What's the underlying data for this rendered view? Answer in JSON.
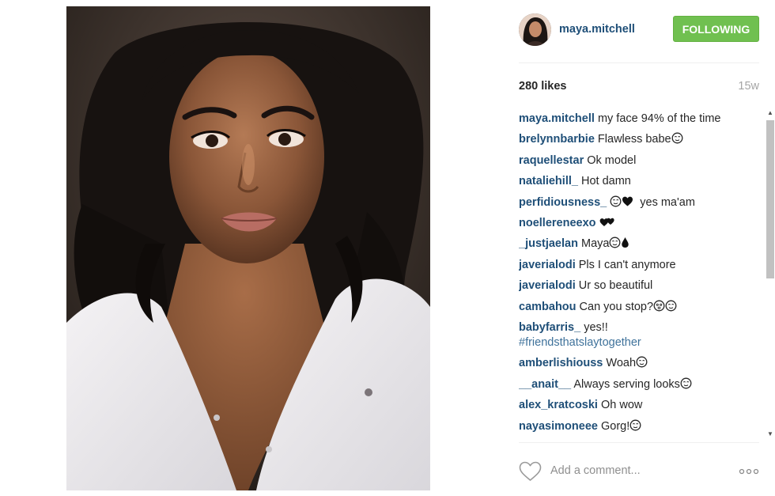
{
  "post": {
    "username": "maya.mitchell",
    "follow_label": "FOLLOWING",
    "likes": "280 likes",
    "time_ago": "15w"
  },
  "comments": [
    {
      "user": "maya.mitchell",
      "text": "my face 94% of the time",
      "emoji": []
    },
    {
      "user": "brelynnbarbie",
      "text": "Flawless babe",
      "emoji": [
        "relieved-face"
      ]
    },
    {
      "user": "raquellestar",
      "text": "Ok model",
      "emoji": []
    },
    {
      "user": "nataliehill_",
      "text": "Hot damn",
      "emoji": []
    },
    {
      "user": "perfidiousness_",
      "text": "yes ma'am",
      "emoji": [
        "relieved-face",
        "black-heart"
      ]
    },
    {
      "user": "noellereneexo",
      "text": "",
      "emoji": [
        "two-hearts"
      ]
    },
    {
      "user": "_justjaelan",
      "text": "Maya",
      "emoji": [
        "relieved-face",
        "droplet"
      ]
    },
    {
      "user": "javerialodi",
      "text": "Pls I can't anymore",
      "emoji": []
    },
    {
      "user": "javerialodi",
      "text": "Ur so beautiful",
      "emoji": []
    },
    {
      "user": "cambahou",
      "text": "Can you stop?",
      "emoji": [
        "dizzy-face",
        "relieved-face"
      ]
    },
    {
      "user": "babyfarris_",
      "text": "yes!!",
      "hashtag": "#friendsthatslaytogether",
      "emoji": []
    },
    {
      "user": "amberlishiouss",
      "text": "Woah",
      "emoji": [
        "relieved-face"
      ]
    },
    {
      "user": "__anait__",
      "text": "Always serving looks",
      "emoji": [
        "relieved-face"
      ]
    },
    {
      "user": "alex_kratcoski",
      "text": "Oh wow",
      "emoji": []
    },
    {
      "user": "nayasimoneee",
      "text": "Gorg!",
      "emoji": [
        "relieved-face"
      ]
    }
  ],
  "comment_box": {
    "placeholder": "Add a comment..."
  },
  "icons": {
    "like": "heart-outline-icon",
    "more": "more-options-icon"
  },
  "colors": {
    "username": "#1f4f78",
    "follow_button": "#70c050",
    "hashtag": "#3f729b",
    "muted": "#a5a5a5"
  }
}
